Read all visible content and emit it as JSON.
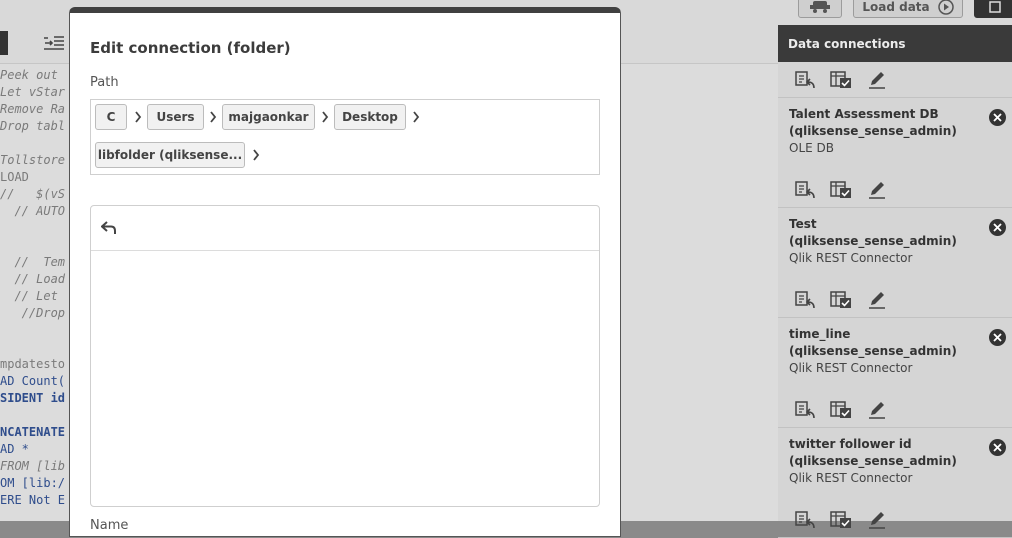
{
  "topbar": {
    "load_label": "Load data"
  },
  "editor": {
    "lines": [
      {
        "text": "Peek out",
        "cls": "it"
      },
      {
        "text": "Let vStar",
        "cls": "it"
      },
      {
        "text": "Remove Ra",
        "cls": "it"
      },
      {
        "text": "Drop tabl",
        "cls": "it"
      },
      {
        "text": "",
        "cls": ""
      },
      {
        "text": "Tollstore",
        "cls": "it"
      },
      {
        "text": "LOAD",
        "cls": ""
      },
      {
        "text": "//   $(vS",
        "cls": "it"
      },
      {
        "text": "  // AUTO",
        "cls": "it"
      },
      {
        "text": "",
        "cls": ""
      },
      {
        "text": "",
        "cls": ""
      },
      {
        "text": "  //  Tem",
        "cls": "it"
      },
      {
        "text": "  // Load",
        "cls": "it"
      },
      {
        "text": "  // Let",
        "cls": "it"
      },
      {
        "text": "   //Drop",
        "cls": "it"
      },
      {
        "text": "",
        "cls": ""
      },
      {
        "text": "",
        "cls": ""
      },
      {
        "text": "mpdatesto",
        "cls": ""
      },
      {
        "text": "AD Count(",
        "cls": "kw"
      },
      {
        "text": "SIDENT id",
        "cls": "kwb"
      },
      {
        "text": "",
        "cls": ""
      },
      {
        "text": "NCATENATE",
        "cls": "kwb"
      },
      {
        "text": "AD *",
        "cls": "kw"
      },
      {
        "text": "FROM [lib",
        "cls": "it"
      },
      {
        "text": "OM [lib:/",
        "cls": "kw"
      },
      {
        "text": "ERE Not E",
        "cls": "kw"
      }
    ]
  },
  "dialog": {
    "title": "Edit connection (folder)",
    "path_label": "Path",
    "crumbs": [
      "C",
      "Users",
      "majgaonkar",
      "Desktop",
      "libfolder (qliksense..."
    ],
    "name_label": "Name"
  },
  "connections": {
    "title": "Data connections",
    "items": [
      {
        "name": "Talent Assessment DB (qliksense_sense_admin)",
        "type": "OLE DB"
      },
      {
        "name": "Test (qliksense_sense_admin)",
        "type": "Qlik REST Connector"
      },
      {
        "name": "time_line (qliksense_sense_admin)",
        "type": "Qlik REST Connector"
      },
      {
        "name": "twitter follower id (qliksense_sense_admin)",
        "type": "Qlik REST Connector"
      }
    ]
  },
  "icons": {
    "select": "select-data-icon",
    "preview": "table-check-icon",
    "edit": "pencil-icon",
    "close": "close-circle-icon",
    "back": "back-arrow-icon",
    "chevron": "chevron-right-icon",
    "indent": "indent-icon",
    "play": "play-circle-icon",
    "robot": "debug-icon"
  },
  "colors": {
    "accent": "#404040",
    "panel": "#d5d5d5",
    "keyword": "#2f4d8c"
  }
}
